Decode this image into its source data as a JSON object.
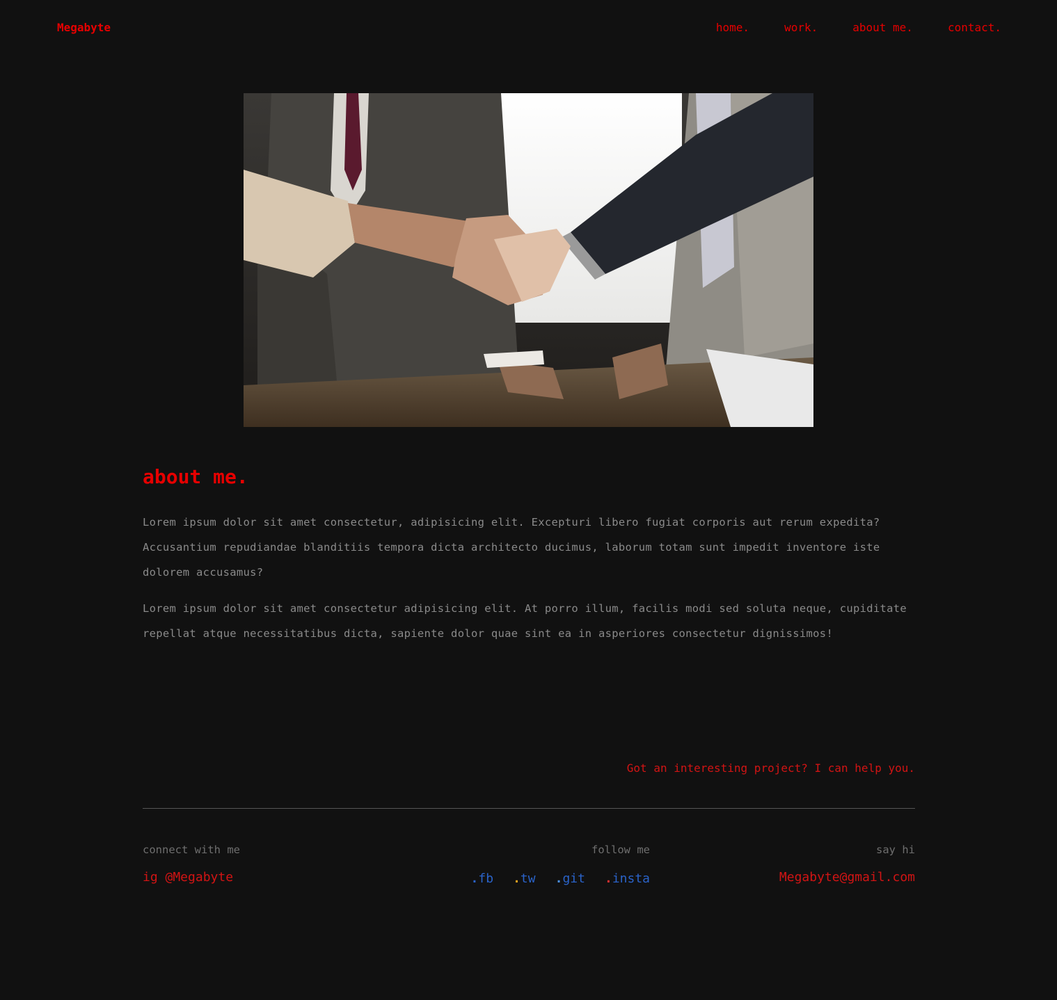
{
  "header": {
    "logo": "Megabyte",
    "nav": [
      "home.",
      "work.",
      "about me.",
      "contact."
    ]
  },
  "hero": {
    "image": "business-handshake-photo"
  },
  "about": {
    "title": "about me.",
    "paragraphs": [
      "Lorem ipsum dolor sit amet consectetur, adipisicing elit. Excepturi libero fugiat corporis aut rerum expedita? Accusantium repudiandae blanditiis tempora dicta architecto ducimus, laborum totam sunt impedit inventore iste dolorem accusamus?",
      "Lorem ipsum dolor sit amet consectetur adipisicing elit. At porro illum, facilis modi sed soluta neque, cupiditate repellat atque necessitatibus dicta, sapiente dolor quae sint ea in asperiores consectetur dignissimos!"
    ]
  },
  "footer": {
    "cta": "Got an interesting project? I can help you.",
    "connect": {
      "label": "connect with me",
      "value": "ig @Megabyte"
    },
    "follow": {
      "label": "follow me",
      "links": [
        {
          "label": "fb",
          "dot_color": "#2a63c9"
        },
        {
          "label": "tw",
          "dot_color": "#e8a020"
        },
        {
          "label": "git",
          "dot_color": "#4a90e2"
        },
        {
          "label": "insta",
          "dot_color": "#e03030"
        }
      ]
    },
    "say_hi": {
      "label": "say hi",
      "email": "Megabyte@gmail.com"
    }
  },
  "colors": {
    "background": "#111111",
    "accent": "#e60000",
    "body_text": "#8a8a8a",
    "link_blue": "#2a63c9"
  }
}
